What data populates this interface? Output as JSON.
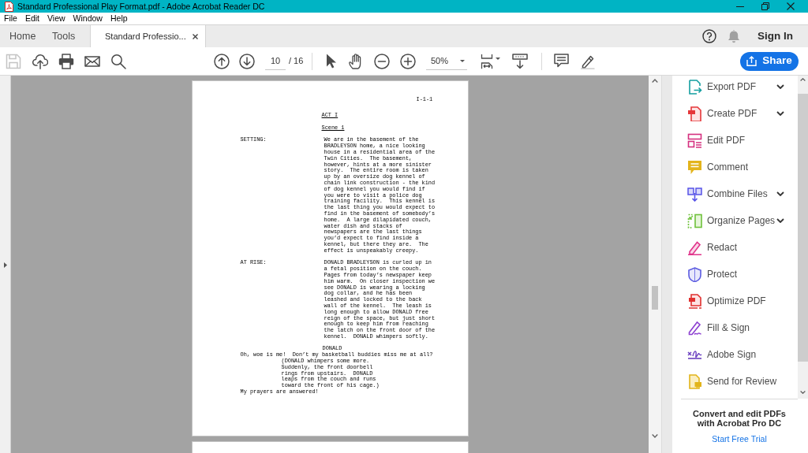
{
  "window": {
    "title": "Standard Professional Play Format.pdf - Adobe Acrobat Reader DC"
  },
  "menu_bar": [
    "File",
    "Edit",
    "View",
    "Window",
    "Help"
  ],
  "tabs": [
    {
      "label": "Home",
      "kind": "nav",
      "selected": false
    },
    {
      "label": "Tools",
      "kind": "nav",
      "selected": false
    },
    {
      "label": "Standard Professio...",
      "kind": "document",
      "selected": true
    }
  ],
  "account": {
    "sign_in": "Sign In"
  },
  "toolbar": {
    "save": {
      "disabled": true
    },
    "page_field": {
      "value": "10"
    },
    "page_total": "/ 16",
    "zoom_field": {
      "value": "50%"
    },
    "share_button": {
      "label": "Share"
    }
  },
  "document": {
    "header": "I-1-1",
    "act": "ACT I",
    "scene": "Scene 1",
    "blocks": [
      {
        "kind": "direction",
        "label": "SETTING:",
        "text": "We are in the basement of the\nBRADLEYSON home, a nice looking\nhouse in a residential area of the\nTwin Cities.  The basement,\nhowever, hints at a more sinister\nstory.  The entire room is taken\nup by an oversize dog kennel of\nchain link construction - the kind\nof dog kennel you would find if\nyou were to visit a police dog\ntraining facility.  This kennel is\nthe last thing you would expect to\nfind in the basement of somebody’s\nhome.  A large dilapidated couch,\nwater dish and stacks of\nnewspapers are the last things\nyou’d expect to find inside a\nkennel, but there they are.  The\neffect is unspeakably creepy."
      },
      {
        "kind": "direction",
        "label": "AT RISE:",
        "text": "DONALD BRADLEYSON is curled up in\na fetal position on the couch.\nPages from today’s newspaper keep\nhim warm.  On closer inspection we\nsee DONALD is wearing a locking\ndog collar, and he has been\nleashed and locked to the back\nwall of the kennel.  The leash is\nlong enough to allow DONALD free\nreign of the space, but just short\nenough to keep him from reaching\nthe latch on the front door of the\nkennel.  DONALD whimpers softly."
      },
      {
        "kind": "character",
        "text": "DONALD"
      },
      {
        "kind": "dialogue",
        "text": "Oh, woe is me!  Don’t my basketball buddies miss me at all?"
      },
      {
        "kind": "parenthetical",
        "text": "(DONALD whimpers some more.\nSuddenly, the front doorbell\nrings from upstairs.  DONALD\nleaps from the couch and runs\ntoward the front of his cage.)"
      },
      {
        "kind": "dialogue",
        "text": "My prayers are answered!"
      }
    ]
  },
  "tools_panel": {
    "items": [
      {
        "label": "Export PDF",
        "kind": "export",
        "expandable": true
      },
      {
        "label": "Create PDF",
        "kind": "create",
        "expandable": true
      },
      {
        "label": "Edit PDF",
        "kind": "edit",
        "expandable": false
      },
      {
        "label": "Comment",
        "kind": "comment",
        "expandable": false
      },
      {
        "label": "Combine Files",
        "kind": "combine",
        "expandable": true
      },
      {
        "label": "Organize Pages",
        "kind": "organize",
        "expandable": true
      },
      {
        "label": "Redact",
        "kind": "redact",
        "expandable": false
      },
      {
        "label": "Protect",
        "kind": "protect",
        "expandable": false
      },
      {
        "label": "Optimize PDF",
        "kind": "optimize",
        "expandable": false
      },
      {
        "label": "Fill & Sign",
        "kind": "fill_sign",
        "expandable": false
      },
      {
        "label": "Adobe Sign",
        "kind": "adobe_sign",
        "expandable": false
      },
      {
        "label": "Send for Review",
        "kind": "review",
        "expandable": false
      }
    ],
    "promo": {
      "text": "Convert and edit PDFs\nwith Acrobat Pro DC",
      "link": "Start Free Trial"
    }
  }
}
